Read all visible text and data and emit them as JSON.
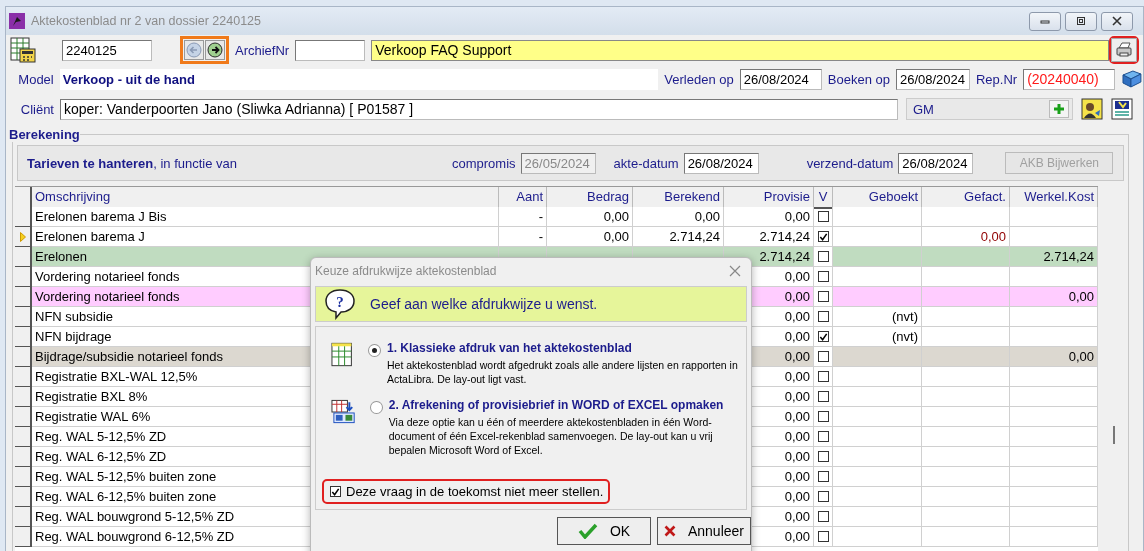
{
  "window": {
    "title": "Aktekostenblad nr 2 van dossier 2240125"
  },
  "header": {
    "dossier": "2240125",
    "archive_label": "ArchiefNr",
    "subject": "Verkoop FAQ Support",
    "model_label": "Model",
    "model": "Verkoop - uit de hand",
    "verleden_label": "Verleden op",
    "verleden": "26/08/2024",
    "boeken_label": "Boeken op",
    "boeken": "26/08/2024",
    "rep_label": "Rep.Nr",
    "rep": "(20240040)",
    "client_label": "Cliënt",
    "client": "koper: Vanderpoorten Jano (Sliwka Adrianna) [ P01587 ]",
    "agent": "GM"
  },
  "berekening": {
    "title": "Berekening",
    "intro": "**Tarieven te hanteren**, in functie van",
    "dates": [
      {
        "label": "compromis",
        "value": "26/05/2024",
        "disabled": true
      },
      {
        "label": "akte-datum",
        "value": "26/08/2024",
        "disabled": false
      },
      {
        "label": "verzend-datum",
        "value": "26/08/2024",
        "disabled": false
      }
    ],
    "update_button": {
      "label": "AKB Bijwerken",
      "disabled": true
    }
  },
  "table": {
    "columns": [
      "Omschrijving",
      "Aant",
      "Bedrag",
      "Berekend",
      "Provisie",
      "V",
      "Geboekt",
      "Gefact.",
      "Werkel.Kost"
    ],
    "rows": [
      {
        "current": false,
        "color": "#ffffff",
        "checked": false,
        "cells": [
          "Erelonen barema J Bis",
          "-",
          "0,00",
          "0,00",
          "0,00",
          null,
          null,
          null,
          null
        ]
      },
      {
        "current": true,
        "color": "#ffffff",
        "checked": true,
        "cells": [
          "Erelonen barema J",
          "-",
          "0,00",
          "2.714,24",
          "2.714,24",
          null,
          null,
          "0,00",
          null
        ]
      },
      {
        "current": false,
        "color": "#c0dcc0",
        "checked": false,
        "cells": [
          "Erelonen",
          null,
          null,
          null,
          "2.714,24",
          null,
          null,
          null,
          "2.714,24"
        ]
      },
      {
        "current": false,
        "color": "#ffffff",
        "checked": false,
        "cells": [
          "Vordering notarieel fonds",
          null,
          null,
          null,
          "0,00",
          null,
          null,
          null,
          null
        ]
      },
      {
        "current": false,
        "color": "#ffccff",
        "checked": false,
        "cells": [
          "Vordering notarieel fonds",
          null,
          null,
          null,
          "0,00",
          null,
          null,
          null,
          "0,00"
        ]
      },
      {
        "current": false,
        "color": "#ffffff",
        "checked": false,
        "cells": [
          "NFN subsidie",
          null,
          null,
          null,
          "0,00",
          null,
          "(nvt)",
          null,
          null
        ]
      },
      {
        "current": false,
        "color": "#ffffff",
        "checked": true,
        "cells": [
          "NFN bijdrage",
          null,
          null,
          null,
          "0,00",
          null,
          "(nvt)",
          null,
          null
        ]
      },
      {
        "current": false,
        "color": "#dcd8d0",
        "checked": false,
        "cells": [
          "Bijdrage/subsidie notarieel fonds",
          null,
          null,
          null,
          "0,00",
          null,
          null,
          null,
          "0,00"
        ]
      },
      {
        "current": false,
        "color": "#ffffff",
        "checked": false,
        "cells": [
          "Registratie BXL-WAL 12,5%",
          null,
          null,
          null,
          "0,00",
          null,
          null,
          null,
          null
        ]
      },
      {
        "current": false,
        "color": "#ffffff",
        "checked": false,
        "cells": [
          "Registratie BXL 8%",
          null,
          null,
          null,
          "0,00",
          null,
          null,
          null,
          null
        ]
      },
      {
        "current": false,
        "color": "#ffffff",
        "checked": false,
        "cells": [
          "Registratie WAL 6%",
          null,
          null,
          null,
          "0,00",
          null,
          null,
          null,
          null
        ]
      },
      {
        "current": false,
        "color": "#ffffff",
        "checked": false,
        "cells": [
          "Reg. WAL 5-12,5% ZD",
          null,
          null,
          null,
          "0,00",
          null,
          null,
          null,
          null
        ]
      },
      {
        "current": false,
        "color": "#ffffff",
        "checked": false,
        "cells": [
          "Reg. WAL 6-12,5% ZD",
          null,
          null,
          null,
          "0,00",
          null,
          null,
          null,
          null
        ]
      },
      {
        "current": false,
        "color": "#ffffff",
        "checked": false,
        "cells": [
          "Reg. WAL 5-12,5% buiten zone",
          null,
          null,
          null,
          "0,00",
          null,
          null,
          null,
          null
        ]
      },
      {
        "current": false,
        "color": "#ffffff",
        "checked": false,
        "cells": [
          "Reg. WAL 6-12,5% buiten zone",
          null,
          null,
          null,
          "0,00",
          null,
          null,
          null,
          null
        ]
      },
      {
        "current": false,
        "color": "#ffffff",
        "checked": false,
        "cells": [
          "Reg. WAL bouwgrond 5-12,5% ZD",
          null,
          null,
          null,
          "0,00",
          null,
          null,
          null,
          null
        ]
      },
      {
        "current": false,
        "color": "#ffffff",
        "checked": false,
        "cells": [
          "Reg. WAL bouwgrond 6-12,5% ZD",
          null,
          null,
          null,
          "0,00",
          null,
          null,
          null,
          null
        ]
      }
    ]
  },
  "dialog": {
    "title": "Keuze afdrukwijze aktekostenblad",
    "icon_glyph": "?",
    "prompt": "Geef aan welke afdrukwijze u wenst.",
    "options": [
      {
        "kind": "sheet",
        "selected": true,
        "title": "1. Klassieke afdruk van het aktekostenblad",
        "description": "Het aktekostenblad wordt afgedrukt zoals alle andere lijsten en rapporten in ActaLibra. De lay-out ligt vast."
      },
      {
        "kind": "export",
        "selected": false,
        "title": "2. Afrekening of provisiebrief in WORD of EXCEL opmaken",
        "description": "Via deze optie kan u één of meerdere aktekostenbladen in één Word-document of één Excel-rekenblad samenvoegen. De lay-out kan u vrij bepalen Microsoft Word of Excel."
      }
    ],
    "dont_ask": {
      "label": "Deze vraag in de toekomst niet meer stellen.",
      "checked": true
    },
    "buttons": [
      {
        "kind": "ok",
        "label": "OK"
      },
      {
        "kind": "cancel",
        "label": "Annuleer"
      }
    ]
  }
}
